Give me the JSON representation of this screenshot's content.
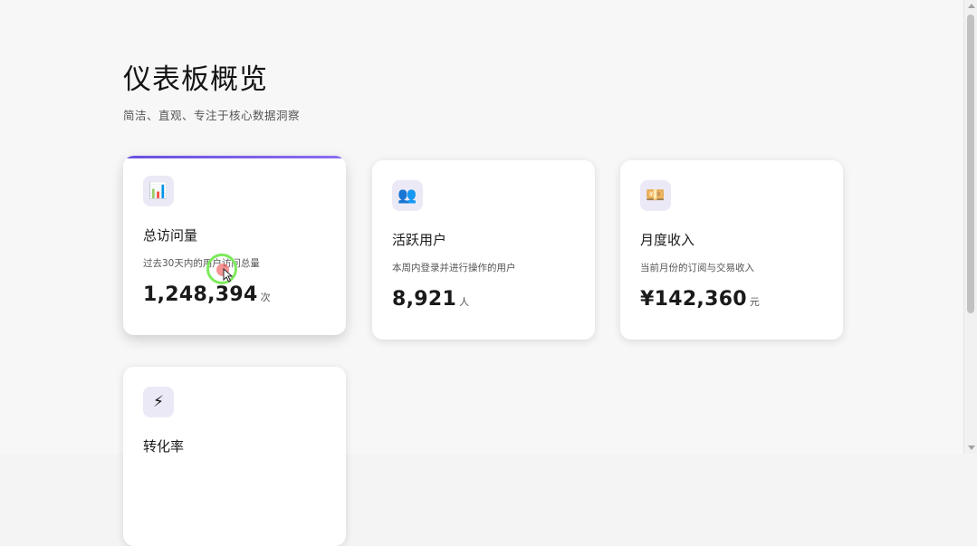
{
  "header": {
    "title": "仪表板概览",
    "subtitle": "简洁、直观、专注于核心数据洞察"
  },
  "colors": {
    "accent": "#6a4fe0",
    "icon_bg": "#ece9f7"
  },
  "cards": [
    {
      "icon": "bar-chart-icon",
      "glyph": "📊",
      "label": "总访问量",
      "desc": "过去30天内的用户访问总量",
      "value": "1,248,394",
      "unit": "次"
    },
    {
      "icon": "users-icon",
      "glyph": "👥",
      "label": "活跃用户",
      "desc": "本周内登录并进行操作的用户",
      "value": "8,921",
      "unit": "人"
    },
    {
      "icon": "money-icon",
      "glyph": "💴",
      "label": "月度收入",
      "desc": "当前月份的订阅与交易收入",
      "value": "¥142,360",
      "unit": "元"
    },
    {
      "icon": "lightning-icon",
      "glyph": "⚡",
      "label": "转化率",
      "desc": "",
      "value": "",
      "unit": ""
    }
  ]
}
